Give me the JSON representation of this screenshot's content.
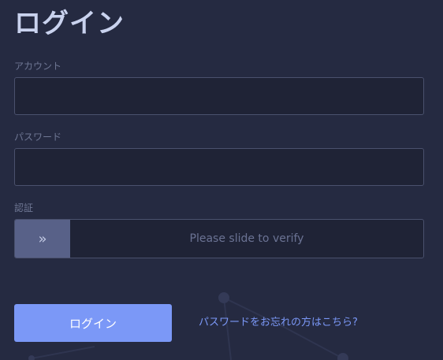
{
  "page": {
    "title": "ログイン"
  },
  "form": {
    "account_label": "アカウント",
    "account_value": "",
    "password_label": "パスワード",
    "password_value": "",
    "verify_label": "認証",
    "slider_text": "Please slide to verify",
    "slider_handle_icon": "double-chevron-right-icon",
    "slider_handle_glyph": "»"
  },
  "actions": {
    "login_label": "ログイン",
    "forgot_label": "パスワードをお忘れの方はこちら?"
  },
  "colors": {
    "background": "#252a41",
    "input_background": "#1f2336",
    "input_border": "#4a516d",
    "accent": "#7b98f7",
    "slider_handle": "#586188"
  }
}
